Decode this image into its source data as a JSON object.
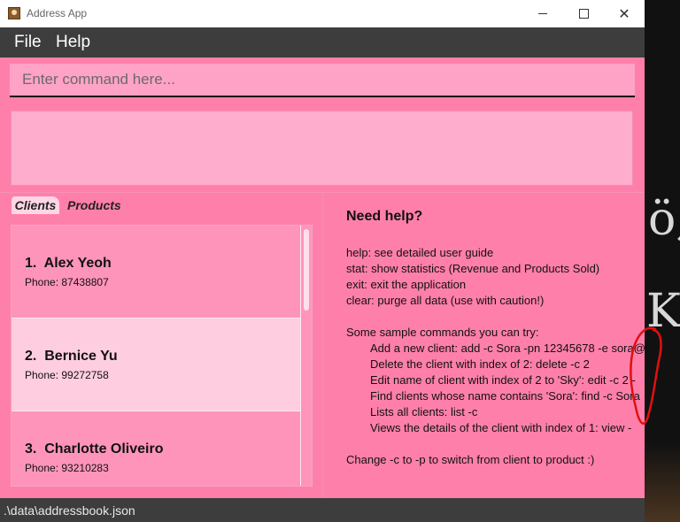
{
  "window": {
    "title": "Address App",
    "controls": {
      "minimize": "minimize",
      "maximize": "maximize",
      "close": "✕"
    }
  },
  "menu": {
    "file": "File",
    "help": "Help"
  },
  "command": {
    "placeholder": "Enter command here...",
    "value": ""
  },
  "result": {
    "text": ""
  },
  "tabs": [
    {
      "label": "Clients",
      "selected": true
    },
    {
      "label": "Products",
      "selected": false
    }
  ],
  "clients": [
    {
      "index": "1.",
      "name": "Alex Yeoh",
      "phone": "Phone: 87438807",
      "selected": false
    },
    {
      "index": "2.",
      "name": "Bernice Yu",
      "phone": "Phone: 99272758",
      "selected": true
    },
    {
      "index": "3.",
      "name": "Charlotte Oliveiro",
      "phone": "Phone: 93210283",
      "selected": false
    }
  ],
  "help": {
    "title": "Need help?",
    "basic": [
      "help: see detailed user guide",
      "stat: show statistics (Revenue and Products Sold)",
      "exit: exit the application",
      "clear: purge all data (use with caution!)"
    ],
    "samples_heading": "Some sample commands you can try:",
    "samples": [
      "Add a new client: add -c Sora -pn 12345678 -e sora@",
      "Delete the client with index of 2: delete -c 2",
      "Edit name of client with index of 2 to 'Sky': edit -c 2 -",
      "Find clients whose name contains 'Sora': find -c Sora",
      "Lists all clients: list -c",
      "Views the details of the client with index of 1: view -"
    ],
    "footer": "Change -c to -p to switch from client to product :)"
  },
  "status": {
    "path": ".\\data\\addressbook.json"
  },
  "colors": {
    "window_bg": "#ff7fab",
    "menubar": "#3d3d3d",
    "list_item": "#ff94bb",
    "list_item_selected": "#ffcde0",
    "annotation": "#e01010"
  }
}
